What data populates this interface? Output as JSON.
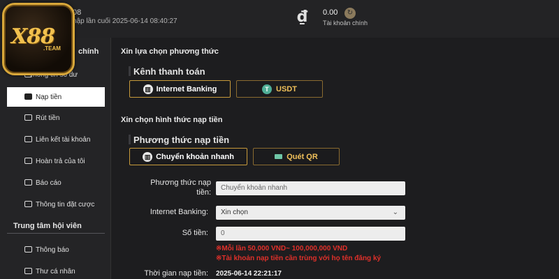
{
  "header": {
    "account_name_partial": "08",
    "last_login_text": "nập lần cuối 2025-06-14 08:40:27",
    "wallet_icon": "dong-sign-icon",
    "balance": "0.00",
    "balance_label": "Tài khoản chính"
  },
  "logo": {
    "text": "X88",
    "sub": ".TEAM"
  },
  "sidebar": {
    "section_partial": "chính",
    "items": [
      {
        "label": "Thông tin số dư",
        "icon": "balance-icon"
      },
      {
        "label": "Nạp tiền",
        "icon": "deposit-icon"
      },
      {
        "label": "Rút tiền",
        "icon": "withdraw-icon"
      },
      {
        "label": "Liên kết tài khoản",
        "icon": "card-icon"
      },
      {
        "label": "Hoàn trả của tôi",
        "icon": "refund-icon"
      },
      {
        "label": "Báo cáo",
        "icon": "report-icon"
      },
      {
        "label": "Thông tin đặt cược",
        "icon": "bet-icon"
      }
    ],
    "member_center_title": "Trung tâm hội viên",
    "member_items": [
      {
        "label": "Thông báo",
        "icon": "notification-icon"
      },
      {
        "label": "Thư cá nhân",
        "icon": "mail-icon"
      }
    ]
  },
  "main": {
    "choose_method_heading": "Xin lựa chọn phương thức",
    "payment_channel_title": "Kênh thanh toán",
    "channel_options": [
      "Internet Banking",
      "USDT"
    ],
    "choose_deposit_heading": "Xin chọn hình thức nạp tiền",
    "deposit_method_title": "Phương thức nạp tiền",
    "method_options": [
      "Chuyển khoản nhanh",
      "Quét QR"
    ],
    "form": {
      "method_label_line1": "Phương thức nạp",
      "method_label_line2": "tiền:",
      "method_value": "Chuyển khoản nhanh",
      "bank_label": "Internet Banking:",
      "bank_value": "Xin chọn",
      "amount_label": "Số tiền:",
      "amount_value": "0",
      "note_limit": "※Mỗi lần 50,000 VND~ 100,000,000 VND",
      "note_name": "※Tài khoản nạp tiền cần trùng với họ tên đăng ký",
      "time_label": "Thời gian nạp tiền:",
      "time_value": "2025-06-14 22:21:17"
    }
  },
  "colors": {
    "accent_gold": "#c79a3b",
    "warning_red": "#e0302a",
    "bg_dark": "#1d1d1f"
  }
}
